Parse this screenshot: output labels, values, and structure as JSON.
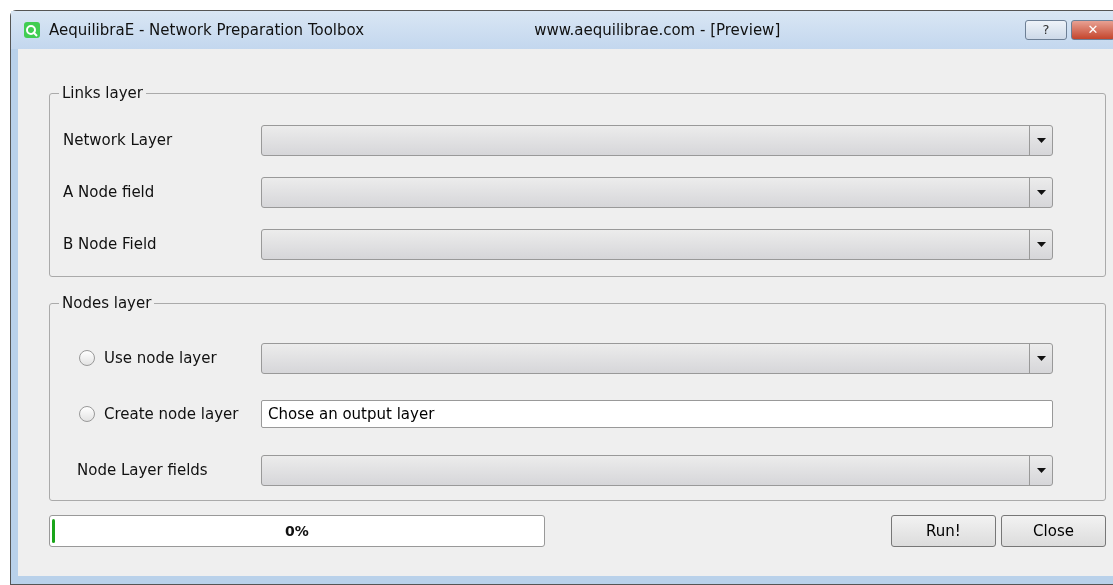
{
  "window": {
    "title": "AequilibraE - Network Preparation Toolbox",
    "subtitle": "www.aequilibrae.com - [Preview]",
    "buttons": [
      {
        "kind": "help",
        "label": "?"
      },
      {
        "kind": "close",
        "label": "✕"
      }
    ]
  },
  "links_group": {
    "title": "Links layer",
    "rows": [
      {
        "label": "Network Layer"
      },
      {
        "label": "A Node field"
      },
      {
        "label": "B Node Field"
      }
    ]
  },
  "nodes_group": {
    "title": "Nodes layer",
    "rows": [
      {
        "kind": "radio-combo",
        "label": "Use node layer",
        "selected": false
      },
      {
        "kind": "radio-input",
        "label": "Create node layer",
        "selected": false,
        "value": "Chose an output layer"
      },
      {
        "kind": "combo",
        "label": "Node Layer fields"
      }
    ]
  },
  "progress": {
    "level": 0,
    "reading": "0%"
  },
  "buttons": [
    "Run!",
    "Close"
  ]
}
